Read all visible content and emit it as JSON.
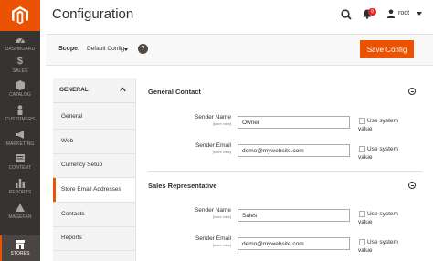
{
  "sidebar": {
    "items": [
      {
        "label": "DASHBOARD",
        "icon": "dashboard-icon"
      },
      {
        "label": "SALES",
        "icon": "dollar-icon"
      },
      {
        "label": "CATALOG",
        "icon": "box-icon"
      },
      {
        "label": "CUSTOMERS",
        "icon": "person-icon"
      },
      {
        "label": "MARKETING",
        "icon": "megaphone-icon"
      },
      {
        "label": "CONTENT",
        "icon": "content-icon"
      },
      {
        "label": "REPORTS",
        "icon": "bar-chart-icon"
      },
      {
        "label": "MAGEFAN",
        "icon": "magefan-icon"
      },
      {
        "label": "STORES",
        "icon": "store-icon"
      }
    ],
    "colors": {
      "background": "#373330",
      "accent": "#eb5202"
    }
  },
  "header": {
    "title": "Configuration",
    "notification_count": "9",
    "username": "root"
  },
  "scope": {
    "label": "Scope:",
    "value": "Default Config",
    "help": "?"
  },
  "save_button": {
    "label": "Save Config"
  },
  "left_panel": {
    "heading": "GENERAL",
    "items": [
      {
        "label": "General"
      },
      {
        "label": "Web"
      },
      {
        "label": "Currency Setup"
      },
      {
        "label": "Store Email Addresses"
      },
      {
        "label": "Contacts"
      },
      {
        "label": "Reports"
      }
    ],
    "active_index": 3
  },
  "sections": [
    {
      "title": "General Contact",
      "fields": [
        {
          "label": "Sender Name",
          "scope": "[store view]",
          "value": "Owner",
          "checkbox_label": "Use system value"
        },
        {
          "label": "Sender Email",
          "scope": "[store view]",
          "value": "demo@mywebsite.com",
          "checkbox_label": "Use system value"
        }
      ]
    },
    {
      "title": "Sales Representative",
      "fields": [
        {
          "label": "Sender Name",
          "scope": "[store view]",
          "value": "Sales",
          "checkbox_label": "Use system value"
        },
        {
          "label": "Sender Email",
          "scope": "[store view]",
          "value": "demo@mywebsite.com",
          "checkbox_label": "Use system value"
        }
      ]
    }
  ]
}
